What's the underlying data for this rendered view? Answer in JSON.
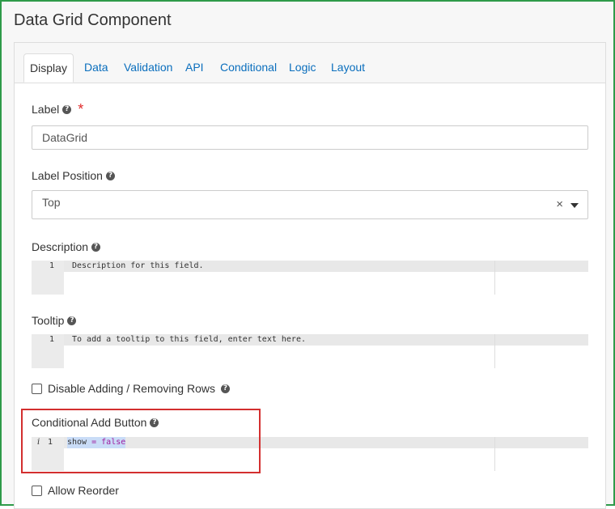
{
  "window": {
    "title": "Data Grid Component"
  },
  "tabs": [
    {
      "label": "Display"
    },
    {
      "label": "Data"
    },
    {
      "label": "Validation"
    },
    {
      "label": "API"
    },
    {
      "label": "Conditional"
    },
    {
      "label": "Logic"
    },
    {
      "label": "Layout"
    }
  ],
  "fields": {
    "label": {
      "label": "Label",
      "value": "DataGrid",
      "required_mark": "*"
    },
    "label_position": {
      "label": "Label Position",
      "value": "Top",
      "clear": "×"
    },
    "description": {
      "label": "Description",
      "line_number": "1",
      "placeholder": "Description for this field."
    },
    "tooltip": {
      "label": "Tooltip",
      "line_number": "1",
      "placeholder": "To add a tooltip to this field, enter text here."
    },
    "disable_adding_removing_rows": {
      "label": "Disable Adding / Removing Rows",
      "checked": false
    },
    "conditional_add_button": {
      "label": "Conditional Add Button",
      "info_marker": "i",
      "line_number": "1",
      "code_tokens": {
        "var": "show",
        "op": " = ",
        "val": "false"
      }
    },
    "allow_reorder": {
      "label": "Allow Reorder",
      "checked": false
    }
  },
  "help_icon_glyph": "?",
  "colors": {
    "frame_border": "#2e9b4a",
    "tab_link": "#0a6ebd",
    "required": "#e02b2b",
    "highlight_border": "#d32f2f"
  }
}
